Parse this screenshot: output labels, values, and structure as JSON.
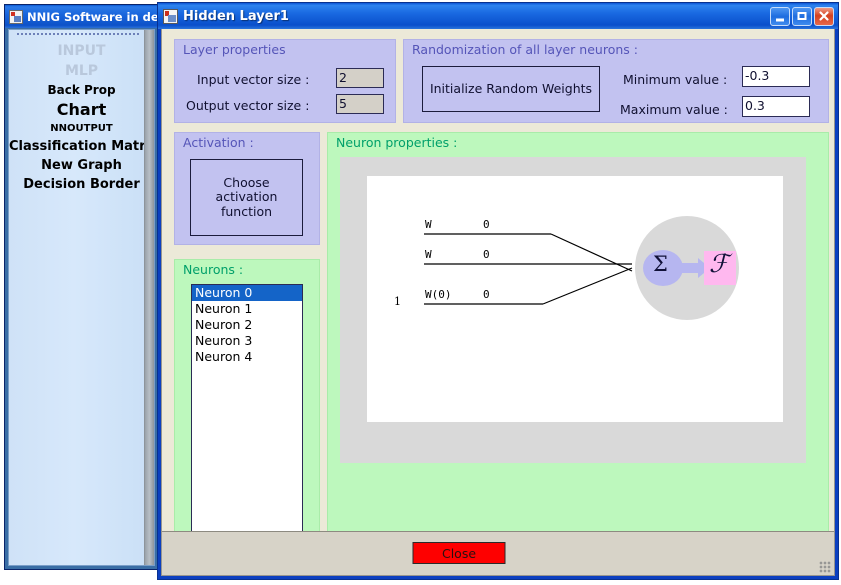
{
  "background_window": {
    "title": "NNIG Software in de",
    "icon": "app-icon",
    "nav_items": [
      {
        "label": "INPUT",
        "size": 14,
        "disabled": true
      },
      {
        "label": "MLP",
        "size": 14,
        "disabled": true
      },
      {
        "label": "Back Prop",
        "size": 12,
        "disabled": false
      },
      {
        "label": "Chart",
        "size": 16,
        "disabled": false
      },
      {
        "label": "NNOUTPUT",
        "size": 10,
        "disabled": false
      },
      {
        "label": "Classification Matrix",
        "size": 13,
        "disabled": false
      },
      {
        "label": "New Graph",
        "size": 13,
        "disabled": false
      },
      {
        "label": "Decision Border",
        "size": 13,
        "disabled": false
      }
    ]
  },
  "dialog": {
    "title": "Hidden Layer1",
    "icon": "window-icon",
    "window_buttons": {
      "minimize": "minimize-icon",
      "maximize": "maximize-icon",
      "close": "close-icon"
    },
    "layer_properties": {
      "caption": "Layer properties",
      "input_vector_label": "Input vector size :",
      "input_vector_value": "2",
      "output_vector_label": "Output vector size :",
      "output_vector_value": "5"
    },
    "randomization": {
      "caption": "Randomization of all layer neurons :",
      "init_button": "Initialize Random Weights",
      "min_label": "Minimum value :",
      "min_value": "-0.3",
      "max_label": "Maximum value :",
      "max_value": "0.3"
    },
    "activation": {
      "caption": "Activation :",
      "choose_button": "Choose activation function"
    },
    "neurons": {
      "caption": "Neurons :",
      "items": [
        "Neuron 0",
        "Neuron 1",
        "Neuron 2",
        "Neuron 3",
        "Neuron 4"
      ],
      "selected_index": 0
    },
    "neuron_properties": {
      "caption": "Neuron properties :",
      "diagram": {
        "bias_input_label": "1",
        "rows": [
          {
            "weight_label": "W",
            "weight_value": "0"
          },
          {
            "weight_label": "W",
            "weight_value": "0"
          },
          {
            "weight_label": "W(0)",
            "weight_value": "0"
          }
        ],
        "sum_symbol": "Σ",
        "function_symbol": "ℱ",
        "sum_badge_color": "#b6b6f0",
        "function_badge_color": "#ffb8ef",
        "body_color": "#d9d9d9"
      }
    },
    "footer": {
      "close_label": "Close",
      "close_color": "#fe0000"
    }
  }
}
